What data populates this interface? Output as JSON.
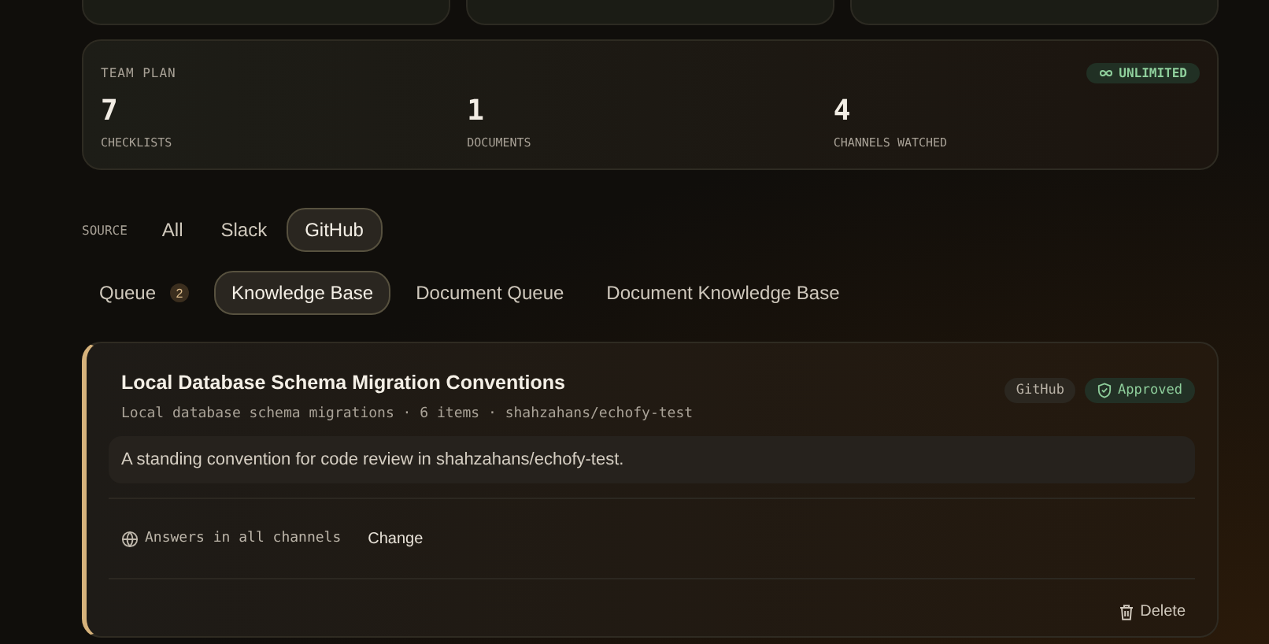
{
  "plan": {
    "title": "TEAM PLAN",
    "badge": "UNLIMITED",
    "stats": [
      {
        "value": "7",
        "label": "CHECKLISTS"
      },
      {
        "value": "1",
        "label": "DOCUMENTS"
      },
      {
        "value": "4",
        "label": "CHANNELS WATCHED"
      }
    ]
  },
  "source_filter": {
    "label": "SOURCE",
    "options": [
      {
        "label": "All",
        "selected": false
      },
      {
        "label": "Slack",
        "selected": false
      },
      {
        "label": "GitHub",
        "selected": true
      }
    ]
  },
  "tabs": [
    {
      "label": "Queue",
      "badge": "2",
      "selected": false
    },
    {
      "label": "Knowledge Base",
      "selected": true
    },
    {
      "label": "Document Queue",
      "selected": false
    },
    {
      "label": "Document Knowledge Base",
      "selected": false
    }
  ],
  "entry": {
    "title": "Local Database Schema Migration Conventions",
    "meta": "Local database schema migrations · 6 items · shahzahans/echofy-test",
    "source_tag": "GitHub",
    "status": "Approved",
    "description": "A standing convention for code review in shahzahans/echofy-test.",
    "scope": "Answers in all channels",
    "change": "Change",
    "delete": "Delete"
  }
}
